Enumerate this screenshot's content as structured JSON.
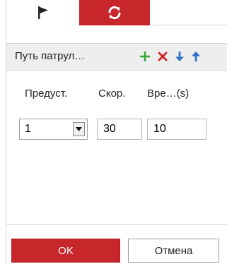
{
  "tabs": [
    {
      "icon": "flag-icon",
      "selected": false
    },
    {
      "icon": "refresh-icon",
      "selected": true
    }
  ],
  "toolbar": {
    "title": "Путь патрул…",
    "actions": [
      {
        "icon": "plus-icon",
        "color": "#3aa537"
      },
      {
        "icon": "close-icon",
        "color": "#d4242a"
      },
      {
        "icon": "arrow-down-icon",
        "color": "#2f72c8"
      },
      {
        "icon": "arrow-up-icon",
        "color": "#2f72c8"
      }
    ]
  },
  "columns": {
    "preset": "Предуст.",
    "speed": "Скор.",
    "time": "Вре…(s)"
  },
  "row": {
    "preset": "1",
    "speed": "30",
    "time": "10"
  },
  "footer": {
    "ok_label": "OK",
    "cancel_label": "Отмена"
  },
  "colors": {
    "accent": "#c7262a",
    "toolbar_bg": "#eeeeee",
    "border": "#d2d2d2"
  }
}
